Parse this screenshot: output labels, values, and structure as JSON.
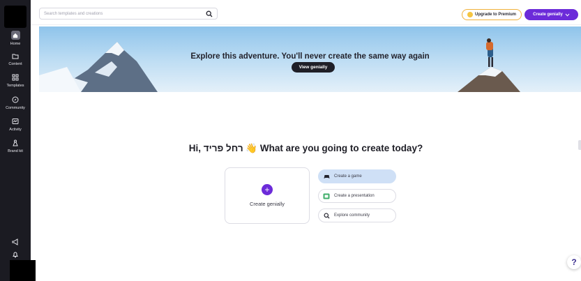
{
  "sidebar": {
    "items": [
      {
        "label": "Home",
        "icon": "home-icon"
      },
      {
        "label": "Content",
        "icon": "folder-icon"
      },
      {
        "label": "Templates",
        "icon": "templates-grid-icon"
      },
      {
        "label": "Community",
        "icon": "compass-icon"
      },
      {
        "label": "Activity",
        "icon": "activity-icon"
      },
      {
        "label": "Brand kit",
        "icon": "brand-kit-icon"
      }
    ],
    "bottom_icons": [
      "megaphone-icon",
      "bell-icon"
    ]
  },
  "topbar": {
    "search_placeholder": "Search templates and creations",
    "premium_label": "Upgrade to Premium",
    "create_label": "Create genially"
  },
  "banner": {
    "title": "Explore this adventure. You'll never create the same way again",
    "button_label": "View genially"
  },
  "main": {
    "greeting": "Hi, רחל פריד 👋 What are you going to create today?",
    "create_card_label": "Create genially",
    "options": [
      {
        "label": "Create a game",
        "icon": "gamepad-icon",
        "active": true
      },
      {
        "label": "Create a presentation",
        "icon": "presentation-icon",
        "active": false
      },
      {
        "label": "Explore community",
        "icon": "search-icon",
        "active": false
      }
    ]
  },
  "help_label": "?",
  "colors": {
    "sidebar_bg": "#1b1b22",
    "accent_purple": "#6c2bd9",
    "premium_border": "#f1b13b",
    "active_option": "#cfe0f6"
  }
}
